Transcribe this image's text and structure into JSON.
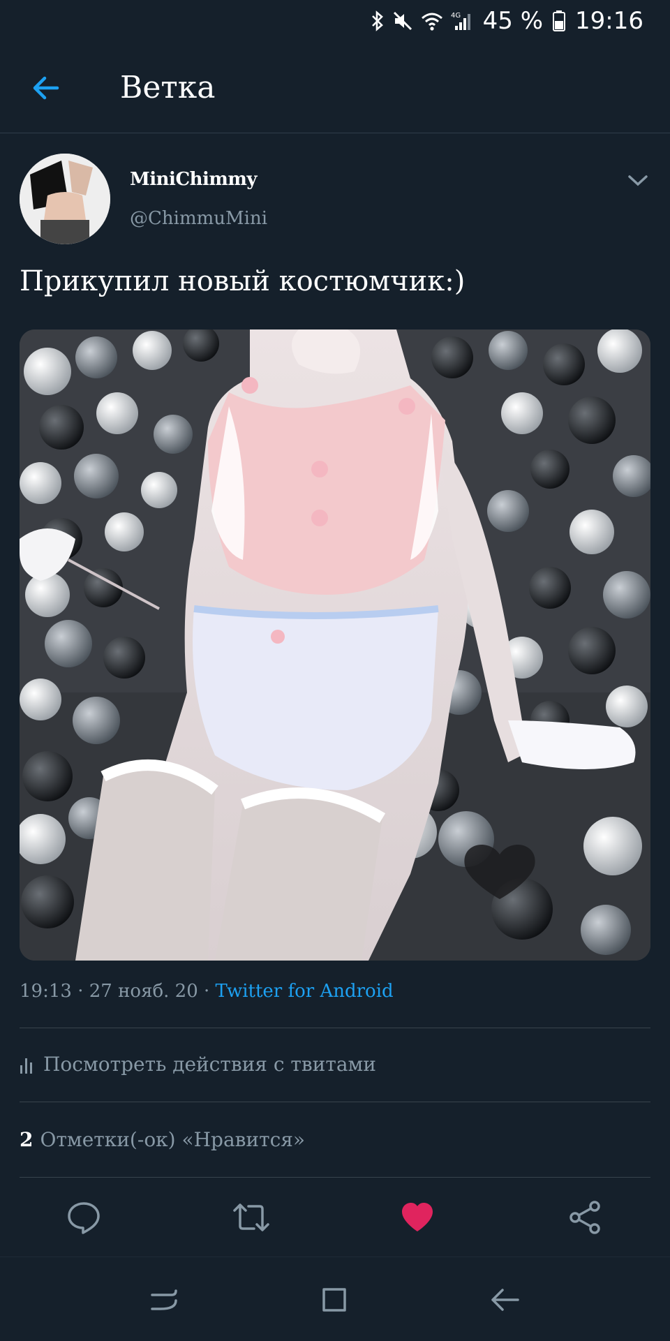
{
  "status_bar": {
    "battery_percent": "45 %",
    "time": "19:16",
    "icons": [
      "bluetooth-icon",
      "mute-icon",
      "wifi-icon",
      "4g-signal-icon",
      "battery-icon"
    ]
  },
  "header": {
    "title": "Ветка",
    "back_icon": "arrow-left-icon",
    "accent_color": "#1da1f2"
  },
  "tweet": {
    "author": {
      "display_name": "MiniChimmy",
      "handle": "@ChimmuMini"
    },
    "text": "Прикупил новый костюмчик:)",
    "meta": {
      "time": "19:13",
      "date": "27 нояб. 20",
      "source": "Twitter for Android"
    },
    "activity_label": "Посмотреть действия с твитами",
    "likes": {
      "count": "2",
      "label": "Отметки(-ок) «Нравится»"
    }
  },
  "actions": [
    {
      "name": "reply-icon"
    },
    {
      "name": "retweet-icon"
    },
    {
      "name": "like-icon",
      "active": true,
      "color": "#e0245e"
    },
    {
      "name": "share-icon"
    }
  ],
  "nav_bar": [
    "recent-apps-icon",
    "home-icon",
    "back-icon"
  ],
  "colors": {
    "background": "#15202b",
    "secondary_text": "#8899a6",
    "divider": "#38444d"
  }
}
